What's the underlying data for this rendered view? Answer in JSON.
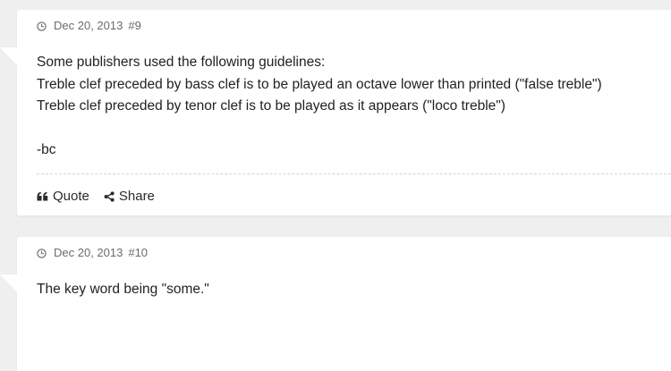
{
  "posts": [
    {
      "date": "Dec 20, 2013",
      "number": "#9",
      "lines": [
        "Some publishers used the following guidelines:",
        "Treble clef preceded by bass clef is to be played an octave lower than printed (\"false treble\")",
        "Treble clef preceded by tenor clef is to be played as it appears (\"loco treble\")",
        "",
        "-bc"
      ],
      "actions": {
        "quote_label": "Quote",
        "share_label": "Share"
      }
    },
    {
      "date": "Dec 20, 2013",
      "number": "#10",
      "lines": [
        "The key word being \"some.\""
      ]
    }
  ],
  "icons": {
    "meta": "clock-icon",
    "quote": "quote-icon",
    "share": "share-icon"
  },
  "colors": {
    "page_background": "#efefef",
    "card_background": "#ffffff",
    "meta_text": "#6b6b6b"
  }
}
